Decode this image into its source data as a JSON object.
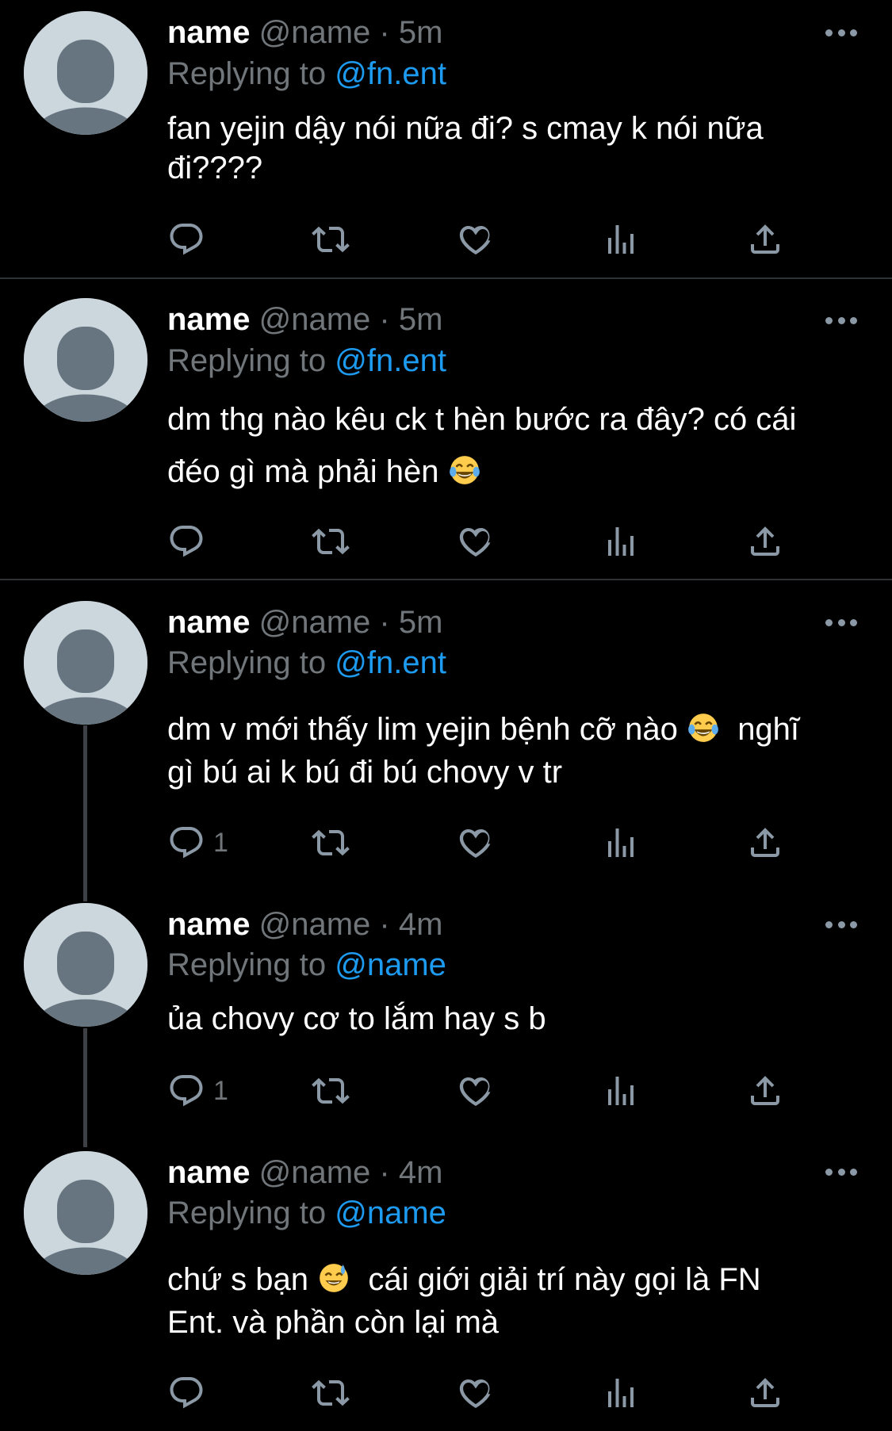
{
  "tweets": [
    {
      "name": "name",
      "handle": "@name",
      "dot": "·",
      "time": "5m",
      "replying_label": "Replying to",
      "replying_to": "@fn.ent",
      "text_line1": "fan yejin dậy nói nữa đi? s cmay k nói nữa",
      "text_line2": "đi????",
      "reply_count": ""
    },
    {
      "name": "name",
      "handle": "@name",
      "dot": "·",
      "time": "5m",
      "replying_label": "Replying to",
      "replying_to": "@fn.ent",
      "text_line1": "dm thg nào kêu ck t hèn bước ra đây? có cái",
      "text_line2": "đéo gì mà phải hèn",
      "text_emoji": "laughing-tears",
      "reply_count": ""
    },
    {
      "name": "name",
      "handle": "@name",
      "dot": "·",
      "time": "5m",
      "replying_label": "Replying to",
      "replying_to": "@fn.ent",
      "text_line1a": "dm v mới thấy lim yejin bệnh cỡ nào",
      "text_emoji": "laughing-tears",
      "text_line1b": "nghĩ",
      "text_line2": "gì bú ai k bú đi bú chovy v tr",
      "reply_count": "1"
    },
    {
      "name": "name",
      "handle": "@name",
      "dot": "·",
      "time": "4m",
      "replying_label": "Replying to",
      "replying_to": "@name",
      "text_line1": "ủa chovy cơ to lắm hay s b",
      "reply_count": "1"
    },
    {
      "name": "name",
      "handle": "@name",
      "dot": "·",
      "time": "4m",
      "replying_label": "Replying to",
      "replying_to": "@name",
      "text_line1a": "chứ s bạn",
      "text_emoji": "sweat-smile",
      "text_line1b": "cái giới giải trí này gọi là FN",
      "text_line2": "Ent. và phần còn lại mà",
      "reply_count": ""
    }
  ],
  "icons": [
    "reply-icon",
    "retweet-icon",
    "like-icon",
    "views-icon",
    "share-icon",
    "more-icon"
  ],
  "colors": {
    "background": "#000000",
    "link": "#1d9bf0",
    "muted": "#71767b",
    "divider": "#2f3336"
  }
}
